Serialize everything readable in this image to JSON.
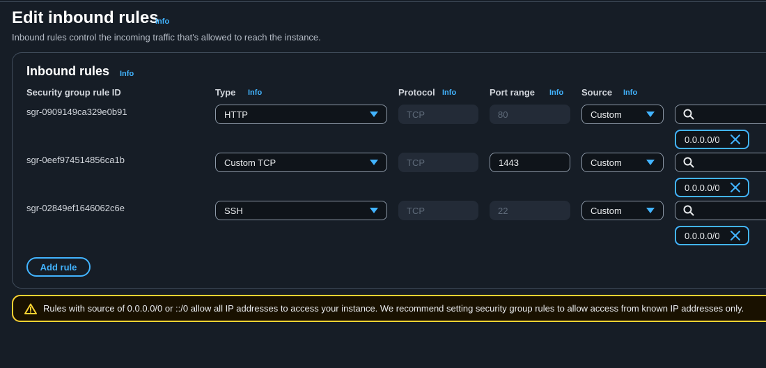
{
  "page": {
    "title": "Edit inbound rules",
    "info": "Info",
    "description": "Inbound rules control the incoming traffic that's allowed to reach the instance."
  },
  "panel": {
    "title": "Inbound rules",
    "info": "Info",
    "columns": {
      "rule_id": "Security group rule ID",
      "type": "Type",
      "type_info": "Info",
      "protocol": "Protocol",
      "protocol_info": "Info",
      "port_range": "Port range",
      "port_range_info": "Info",
      "source": "Source",
      "source_info": "Info"
    },
    "rules": [
      {
        "id": "sgr-0909149ca329e0b91",
        "type": "HTTP",
        "protocol": "TCP",
        "port": "80",
        "source": "Custom",
        "cidr": "0.0.0.0/0"
      },
      {
        "id": "sgr-0eef974514856ca1b",
        "type": "Custom TCP",
        "protocol": "TCP",
        "port": "1443",
        "source": "Custom",
        "cidr": "0.0.0.0/0"
      },
      {
        "id": "sgr-02849ef1646062c6e",
        "type": "SSH",
        "protocol": "TCP",
        "port": "22",
        "source": "Custom",
        "cidr": "0.0.0.0/0"
      }
    ],
    "add_rule_label": "Add rule"
  },
  "warning": {
    "icon": "warning-triangle-icon",
    "text": "Rules with source of 0.0.0.0/0 or ::/0 allow all IP addresses to access your instance. We recommend setting security group rules to allow access from known IP addresses only."
  },
  "colors": {
    "background": "#161d26",
    "accent": "#42b4ff",
    "warning": "#fbd332"
  }
}
